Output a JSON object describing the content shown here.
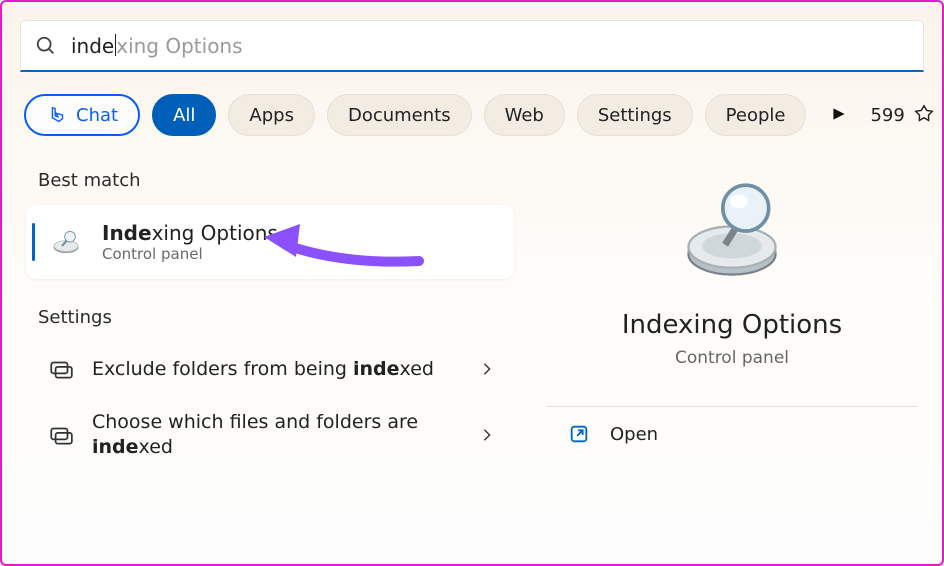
{
  "search": {
    "typed": "inde",
    "suffix": "xing Options"
  },
  "filters": {
    "chat": "Chat",
    "all": "All",
    "apps": "Apps",
    "documents": "Documents",
    "web": "Web",
    "settings": "Settings",
    "people": "People",
    "points": "599"
  },
  "sections": {
    "best_match": "Best match",
    "settings": "Settings"
  },
  "best_match": {
    "title_prefix": "Inde",
    "title_rest": "xing Options",
    "subtitle": "Control panel"
  },
  "settings_items": [
    {
      "pre": "Exclude folders from being ",
      "bold": "inde",
      "post": "xed"
    },
    {
      "pre": "Choose which files and folders are ",
      "bold": "inde",
      "post": "xed"
    }
  ],
  "preview": {
    "title": "Indexing Options",
    "subtitle": "Control panel"
  },
  "actions": {
    "open": "Open"
  }
}
